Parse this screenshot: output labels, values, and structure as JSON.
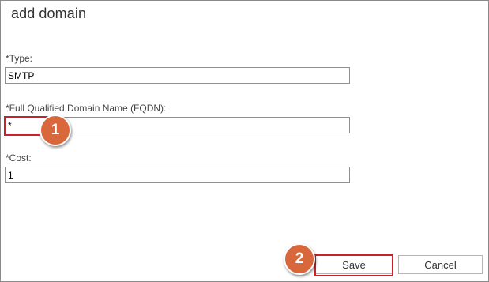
{
  "dialog": {
    "title": "add domain"
  },
  "fields": {
    "type": {
      "label": "*Type:",
      "value": "SMTP"
    },
    "fqdn": {
      "label": "*Full Qualified Domain Name (FQDN):",
      "value": "*"
    },
    "cost": {
      "label": "*Cost:",
      "value": "1"
    }
  },
  "buttons": {
    "save_label": "Save",
    "cancel_label": "Cancel"
  },
  "annotations": {
    "step1": "1",
    "step2": "2",
    "badge_color": "#d9673c",
    "highlight_color": "#cc1f2a"
  }
}
